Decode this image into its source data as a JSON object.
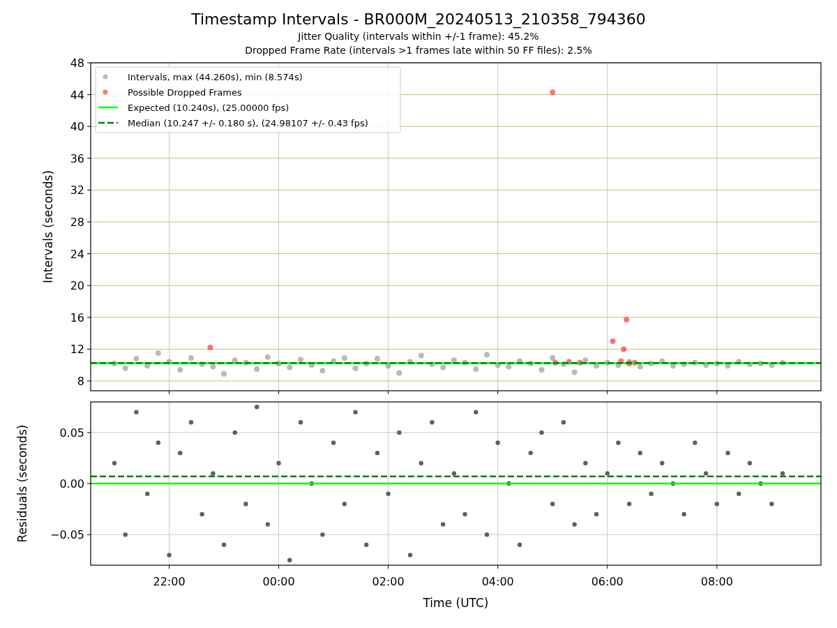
{
  "figure": {
    "title": "Timestamp Intervals - BR000M_20240513_210358_794360",
    "subtitles": [
      "Jitter Quality (intervals within +/-1 frame): 45.2%",
      "Dropped Frame Rate (intervals >1 frames late within 50 FF files): 2.5%"
    ]
  },
  "panels": [
    {
      "chart_data": {
        "type": "scatter",
        "ylabel": "Intervals (seconds)",
        "grid": true,
        "legend": "upper left",
        "x": [
          "2024-05-13T21:00",
          "2024-05-13T21:12",
          "2024-05-13T21:24",
          "2024-05-13T21:36",
          "2024-05-13T21:48",
          "2024-05-13T22:00",
          "2024-05-13T22:12",
          "2024-05-13T22:24",
          "2024-05-13T22:36",
          "2024-05-13T22:48",
          "2024-05-13T23:00",
          "2024-05-13T23:12",
          "2024-05-13T23:24",
          "2024-05-13T23:36",
          "2024-05-13T23:48",
          "2024-05-14T00:00",
          "2024-05-14T00:12",
          "2024-05-14T00:24",
          "2024-05-14T00:36",
          "2024-05-14T00:48",
          "2024-05-14T01:00",
          "2024-05-14T01:12",
          "2024-05-14T01:24",
          "2024-05-14T01:36",
          "2024-05-14T01:48",
          "2024-05-14T02:00",
          "2024-05-14T02:12",
          "2024-05-14T02:24",
          "2024-05-14T02:36",
          "2024-05-14T02:48",
          "2024-05-14T03:00",
          "2024-05-14T03:12",
          "2024-05-14T03:24",
          "2024-05-14T03:36",
          "2024-05-14T03:48",
          "2024-05-14T04:00",
          "2024-05-14T04:12",
          "2024-05-14T04:24",
          "2024-05-14T04:36",
          "2024-05-14T04:48",
          "2024-05-14T05:00",
          "2024-05-14T05:12",
          "2024-05-14T05:24",
          "2024-05-14T05:36",
          "2024-05-14T05:48",
          "2024-05-14T06:00",
          "2024-05-14T06:12",
          "2024-05-14T06:24",
          "2024-05-14T06:36",
          "2024-05-14T06:48",
          "2024-05-14T07:00",
          "2024-05-14T07:12",
          "2024-05-14T07:24",
          "2024-05-14T07:36",
          "2024-05-14T07:48",
          "2024-05-14T08:00",
          "2024-05-14T08:12",
          "2024-05-14T08:24",
          "2024-05-14T08:36",
          "2024-05-14T08:48",
          "2024-05-14T09:00",
          "2024-05-14T09:12"
        ],
        "series": [
          {
            "name": "Intervals, max (44.260s), min (8.574s)",
            "color": "#808080",
            "values": [
              10.2,
              9.6,
              10.8,
              9.9,
              11.5,
              10.4,
              9.4,
              10.9,
              10.1,
              9.8,
              8.9,
              10.6,
              10.3,
              9.5,
              11.0,
              10.2,
              9.7,
              10.7,
              10.0,
              9.3,
              10.5,
              10.9,
              9.6,
              10.2,
              10.8,
              9.9,
              9.0,
              10.4,
              11.2,
              10.1,
              9.7,
              10.6,
              10.3,
              9.5,
              11.3,
              10.0,
              9.8,
              10.5,
              10.2,
              9.4,
              10.9,
              10.1,
              9.1,
              10.6,
              9.9,
              10.3,
              10.0,
              10.4,
              9.8,
              10.2,
              10.5,
              9.9,
              10.1,
              10.3,
              10.0,
              10.2,
              9.9,
              10.4,
              10.1,
              10.2,
              10.0,
              10.3
            ]
          },
          {
            "name": "Possible Dropped Frames",
            "color": "#ff0000",
            "x": [
              "2024-05-13T22:45",
              "2024-05-14T05:00",
              "2024-05-14T05:03",
              "2024-05-14T05:18",
              "2024-05-14T05:30",
              "2024-05-14T06:06",
              "2024-05-14T06:15",
              "2024-05-14T06:18",
              "2024-05-14T06:21",
              "2024-05-14T06:24",
              "2024-05-14T06:30"
            ],
            "values": [
              12.2,
              44.3,
              10.3,
              10.4,
              10.3,
              13.0,
              10.5,
              12.0,
              15.7,
              10.2,
              10.3
            ]
          }
        ],
        "ref_lines": [
          {
            "axis": "y",
            "value": 10.24,
            "color": "#00ff00",
            "label": "Expected (10.240s), (25.00000 fps)"
          },
          {
            "axis": "y",
            "value": 10.247,
            "color": "#008000",
            "label": "Median (10.247 +/- 0.180 s), (24.98107 +/- 0.43 fps)"
          }
        ],
        "xlim": [
          "2024-05-13T20:34",
          "2024-05-14T09:54"
        ],
        "ylim": [
          6.77,
          48
        ],
        "yticks": [
          {
            "value": 8,
            "label": "8"
          },
          {
            "value": 12,
            "label": "12"
          },
          {
            "value": 16,
            "label": "16"
          },
          {
            "value": 20,
            "label": "20"
          },
          {
            "value": 24,
            "label": "24"
          },
          {
            "value": 28,
            "label": "28"
          },
          {
            "value": 32,
            "label": "32"
          },
          {
            "value": 36,
            "label": "36"
          },
          {
            "value": 40,
            "label": "40"
          },
          {
            "value": 44,
            "label": "44"
          },
          {
            "value": 48,
            "label": "48"
          }
        ]
      }
    },
    {
      "chart_data": {
        "type": "scatter",
        "xlabel": "Time (UTC)",
        "ylabel": "Residuals (seconds)",
        "grid": true,
        "x": [
          "2024-05-13T21:00",
          "2024-05-13T21:12",
          "2024-05-13T21:24",
          "2024-05-13T21:36",
          "2024-05-13T21:48",
          "2024-05-13T22:00",
          "2024-05-13T22:12",
          "2024-05-13T22:24",
          "2024-05-13T22:36",
          "2024-05-13T22:48",
          "2024-05-13T23:00",
          "2024-05-13T23:12",
          "2024-05-13T23:24",
          "2024-05-13T23:36",
          "2024-05-13T23:48",
          "2024-05-14T00:00",
          "2024-05-14T00:12",
          "2024-05-14T00:24",
          "2024-05-14T00:36",
          "2024-05-14T00:48",
          "2024-05-14T01:00",
          "2024-05-14T01:12",
          "2024-05-14T01:24",
          "2024-05-14T01:36",
          "2024-05-14T01:48",
          "2024-05-14T02:00",
          "2024-05-14T02:12",
          "2024-05-14T02:24",
          "2024-05-14T02:36",
          "2024-05-14T02:48",
          "2024-05-14T03:00",
          "2024-05-14T03:12",
          "2024-05-14T03:24",
          "2024-05-14T03:36",
          "2024-05-14T03:48",
          "2024-05-14T04:00",
          "2024-05-14T04:12",
          "2024-05-14T04:24",
          "2024-05-14T04:36",
          "2024-05-14T04:48",
          "2024-05-14T05:00",
          "2024-05-14T05:12",
          "2024-05-14T05:24",
          "2024-05-14T05:36",
          "2024-05-14T05:48",
          "2024-05-14T06:00",
          "2024-05-14T06:12",
          "2024-05-14T06:24",
          "2024-05-14T06:36",
          "2024-05-14T06:48",
          "2024-05-14T07:00",
          "2024-05-14T07:12",
          "2024-05-14T07:24",
          "2024-05-14T07:36",
          "2024-05-14T07:48",
          "2024-05-14T08:00",
          "2024-05-14T08:12",
          "2024-05-14T08:24",
          "2024-05-14T08:36",
          "2024-05-14T08:48",
          "2024-05-14T09:00",
          "2024-05-14T09:12"
        ],
        "series": [
          {
            "color": "#606060",
            "values": [
              0.02,
              -0.05,
              0.07,
              -0.01,
              0.04,
              -0.07,
              0.03,
              0.06,
              -0.03,
              0.01,
              -0.06,
              0.05,
              -0.02,
              0.075,
              -0.04,
              0.02,
              -0.075,
              0.06,
              0.0,
              -0.05,
              0.04,
              -0.02,
              0.07,
              -0.06,
              0.03,
              -0.01,
              0.05,
              -0.07,
              0.02,
              0.06,
              -0.04,
              0.01,
              -0.03,
              0.07,
              -0.05,
              0.04,
              0.0,
              -0.06,
              0.03,
              0.05,
              -0.02,
              0.06,
              -0.04,
              0.02,
              -0.03,
              0.01,
              0.04,
              -0.02,
              0.03,
              -0.01,
              0.02,
              0.0,
              -0.03,
              0.04,
              0.01,
              -0.02,
              0.03,
              -0.01,
              0.02,
              0.0,
              -0.02,
              0.01
            ]
          }
        ],
        "ref_lines": [
          {
            "axis": "y",
            "value": 0,
            "color": "#00ff00"
          },
          {
            "axis": "y",
            "value": 0.007,
            "color": "#008000"
          }
        ],
        "xlim": [
          "2024-05-13T20:34",
          "2024-05-14T09:54"
        ],
        "ylim": [
          -0.08,
          0.08
        ],
        "xticks": [
          {
            "value": "2024-05-13T22:00",
            "label": "22:00"
          },
          {
            "value": "2024-05-14T00:00",
            "label": "00:00"
          },
          {
            "value": "2024-05-14T02:00",
            "label": "02:00"
          },
          {
            "value": "2024-05-14T04:00",
            "label": "04:00"
          },
          {
            "value": "2024-05-14T06:00",
            "label": "06:00"
          },
          {
            "value": "2024-05-14T08:00",
            "label": "08:00"
          }
        ],
        "yticks": [
          {
            "value": 0.05,
            "label": "0.05"
          },
          {
            "value": 0,
            "label": "0.00"
          },
          {
            "value": -0.05,
            "label": "−0.05"
          }
        ]
      }
    }
  ]
}
